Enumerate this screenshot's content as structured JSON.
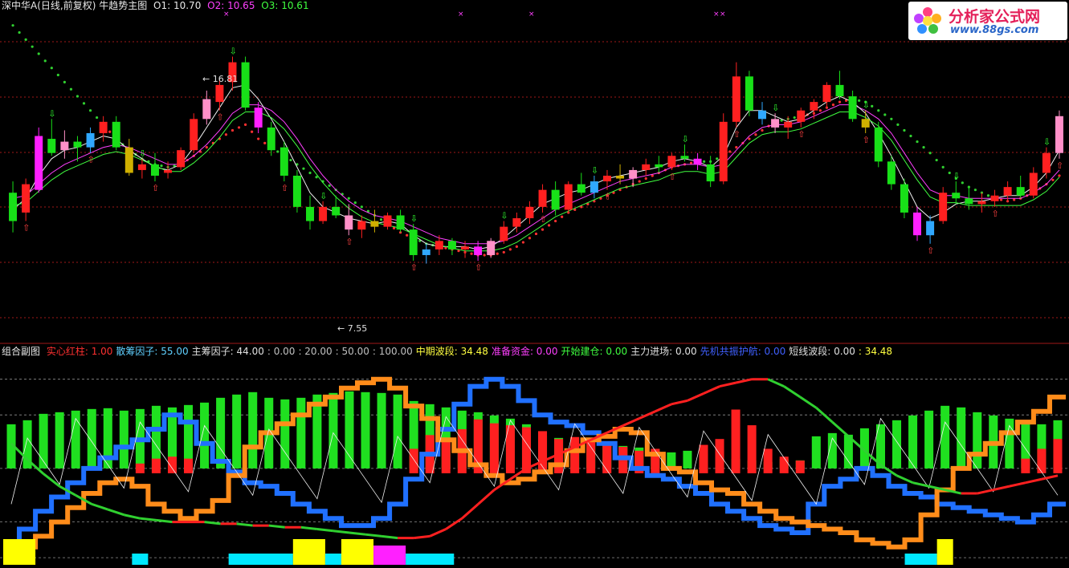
{
  "header": {
    "title": "深中华A(日线,前复权) 牛趋势主图",
    "o1_label": "O1: 10.70",
    "o2_label": "O2: 10.65",
    "o3_label": "O3: 10.61"
  },
  "subheader": {
    "name": "组合副图",
    "items": [
      {
        "label": "实心红柱: 1.00",
        "color": "#ff3030"
      },
      {
        "label": "散筹因子: 55.00",
        "color": "#60d0ff"
      },
      {
        "label": "主筹因子: 44.00",
        "color": "#e0e0e0"
      },
      {
        "label": ": 0.00",
        "color": "#c0c0c0"
      },
      {
        "label": ": 20.00",
        "color": "#c0c0c0"
      },
      {
        "label": ": 50.00",
        "color": "#c0c0c0"
      },
      {
        "label": ": 100.00",
        "color": "#c0c0c0"
      },
      {
        "label": "中期波段: 34.48",
        "color": "#ffff40"
      },
      {
        "label": "准备资金: 0.00",
        "color": "#ff40ff"
      },
      {
        "label": "开始建仓: 0.00",
        "color": "#40ff40"
      },
      {
        "label": "主力进场: 0.00",
        "color": "#e0e0e0"
      },
      {
        "label": "先机共振护航: 0.00",
        "color": "#4060ff"
      },
      {
        "label": "短线波段: 0.00",
        "color": "#e0e0e0"
      },
      {
        "label": ": 34.48",
        "color": "#ffff40"
      }
    ]
  },
  "logo": {
    "name": "分析家公式网",
    "url": "www.88gs.com"
  },
  "colors": {
    "up": "#ff2020",
    "down": "#18e018",
    "grid": "#a01818",
    "orange": "#ff8c1a",
    "blue": "#2070ff",
    "cyan": "#00e8ff",
    "yellow": "#ffff00",
    "magenta": "#ff20ff",
    "pink": "#ff90c8",
    "sky": "#30a8ff"
  },
  "chart_data": [
    {
      "type": "candlestick",
      "title": "牛趋势主图",
      "annotations": [
        {
          "text": "16.81",
          "kind": "high"
        },
        {
          "text": "7.55",
          "kind": "low"
        }
      ],
      "ylim": [
        6.8,
        18.4
      ],
      "candles": [
        [
          12.0,
          12.4,
          10.6,
          11.0
        ],
        [
          11.3,
          12.5,
          11.0,
          12.3
        ],
        [
          12.1,
          14.3,
          12.0,
          14.0
        ],
        [
          13.9,
          14.6,
          13.3,
          13.4
        ],
        [
          13.5,
          14.2,
          13.2,
          13.8
        ],
        [
          13.8,
          14.0,
          13.1,
          13.6
        ],
        [
          13.6,
          14.3,
          13.4,
          14.1
        ],
        [
          14.1,
          14.7,
          13.8,
          14.5
        ],
        [
          14.5,
          14.7,
          13.5,
          13.6
        ],
        [
          13.6,
          13.9,
          12.6,
          12.7
        ],
        [
          12.8,
          13.2,
          12.5,
          13.0
        ],
        [
          13.0,
          13.4,
          12.4,
          12.6
        ],
        [
          12.7,
          13.1,
          12.5,
          12.8
        ],
        [
          12.9,
          13.6,
          12.8,
          13.5
        ],
        [
          13.5,
          14.8,
          13.4,
          14.6
        ],
        [
          14.6,
          15.6,
          14.4,
          15.3
        ],
        [
          15.2,
          16.0,
          14.9,
          15.8
        ],
        [
          15.9,
          16.8,
          15.6,
          16.6
        ],
        [
          16.6,
          16.8,
          14.9,
          15.0
        ],
        [
          15.0,
          15.2,
          14.1,
          14.3
        ],
        [
          14.3,
          14.5,
          13.3,
          13.5
        ],
        [
          13.6,
          13.8,
          12.4,
          12.6
        ],
        [
          12.6,
          12.8,
          11.3,
          11.5
        ],
        [
          11.5,
          11.9,
          10.7,
          11.0
        ],
        [
          11.0,
          11.7,
          10.9,
          11.5
        ],
        [
          11.5,
          11.9,
          11.1,
          11.2
        ],
        [
          11.2,
          11.6,
          10.5,
          10.7
        ],
        [
          10.7,
          11.2,
          10.4,
          11.0
        ],
        [
          11.0,
          11.4,
          10.6,
          10.8
        ],
        [
          10.8,
          11.3,
          10.7,
          11.2
        ],
        [
          11.2,
          11.4,
          10.6,
          10.7
        ],
        [
          10.7,
          10.9,
          9.6,
          9.8
        ],
        [
          9.8,
          10.2,
          9.5,
          10.0
        ],
        [
          10.0,
          10.5,
          9.8,
          10.3
        ],
        [
          10.3,
          10.4,
          9.8,
          10.0
        ],
        [
          10.0,
          10.3,
          9.7,
          10.1
        ],
        [
          10.1,
          10.3,
          9.6,
          9.8
        ],
        [
          9.8,
          10.4,
          9.7,
          10.3
        ],
        [
          10.3,
          11.0,
          10.2,
          10.8
        ],
        [
          10.8,
          11.3,
          10.6,
          11.1
        ],
        [
          11.1,
          11.7,
          10.9,
          11.5
        ],
        [
          11.5,
          12.3,
          11.3,
          12.1
        ],
        [
          12.1,
          12.4,
          11.2,
          11.4
        ],
        [
          11.4,
          12.4,
          11.3,
          12.3
        ],
        [
          12.3,
          12.7,
          11.9,
          12.0
        ],
        [
          12.0,
          12.6,
          11.8,
          12.4
        ],
        [
          12.4,
          12.8,
          12.1,
          12.6
        ],
        [
          12.6,
          13.0,
          12.3,
          12.5
        ],
        [
          12.5,
          12.9,
          12.2,
          12.8
        ],
        [
          12.8,
          13.2,
          12.6,
          13.0
        ],
        [
          13.0,
          13.3,
          12.7,
          12.9
        ],
        [
          12.9,
          13.4,
          12.8,
          13.3
        ],
        [
          13.3,
          13.7,
          13.1,
          13.2
        ],
        [
          13.2,
          13.4,
          12.8,
          13.0
        ],
        [
          13.0,
          13.3,
          12.2,
          12.4
        ],
        [
          12.4,
          14.8,
          12.3,
          14.5
        ],
        [
          14.5,
          16.6,
          14.3,
          16.1
        ],
        [
          16.1,
          16.3,
          14.7,
          14.9
        ],
        [
          14.9,
          15.2,
          14.4,
          14.6
        ],
        [
          14.6,
          14.8,
          14.1,
          14.3
        ],
        [
          14.3,
          14.7,
          13.9,
          14.5
        ],
        [
          14.5,
          15.0,
          14.3,
          14.9
        ],
        [
          14.9,
          15.3,
          14.6,
          15.2
        ],
        [
          15.2,
          15.9,
          15.0,
          15.8
        ],
        [
          15.8,
          16.3,
          15.3,
          15.4
        ],
        [
          15.4,
          15.6,
          14.5,
          14.6
        ],
        [
          14.6,
          14.9,
          14.1,
          14.3
        ],
        [
          14.3,
          14.5,
          12.9,
          13.1
        ],
        [
          13.1,
          13.3,
          12.1,
          12.3
        ],
        [
          12.3,
          12.5,
          11.1,
          11.3
        ],
        [
          11.3,
          11.5,
          10.3,
          10.5
        ],
        [
          10.5,
          11.2,
          10.2,
          11.0
        ],
        [
          11.0,
          12.2,
          10.9,
          12.0
        ],
        [
          12.0,
          12.4,
          11.6,
          11.8
        ],
        [
          11.8,
          12.2,
          11.4,
          11.6
        ],
        [
          11.6,
          12.0,
          11.3,
          11.7
        ],
        [
          11.7,
          12.1,
          11.5,
          11.9
        ],
        [
          11.9,
          12.4,
          11.7,
          12.2
        ],
        [
          12.2,
          12.6,
          11.8,
          11.9
        ],
        [
          11.9,
          12.9,
          11.8,
          12.7
        ],
        [
          12.7,
          13.6,
          12.5,
          13.4
        ],
        [
          13.4,
          14.9,
          13.2,
          14.7
        ]
      ],
      "ma_fast": [
        11.4,
        11.8,
        12.6,
        13.2,
        13.5,
        13.6,
        13.8,
        14.0,
        13.9,
        13.5,
        13.2,
        12.9,
        12.8,
        13.0,
        13.6,
        14.3,
        15.0,
        15.7,
        15.8,
        15.3,
        14.6,
        13.8,
        12.9,
        12.0,
        11.5,
        11.3,
        11.1,
        11.0,
        10.9,
        11.0,
        10.9,
        10.5,
        10.2,
        10.1,
        10.1,
        10.1,
        10.0,
        10.1,
        10.4,
        10.8,
        11.2,
        11.6,
        11.8,
        12.0,
        12.1,
        12.3,
        12.5,
        12.6,
        12.7,
        12.8,
        12.9,
        13.1,
        13.2,
        13.1,
        12.9,
        13.3,
        14.3,
        14.9,
        14.9,
        14.7,
        14.5,
        14.6,
        14.9,
        15.2,
        15.4,
        15.2,
        14.8,
        14.1,
        13.3,
        12.4,
        11.5,
        11.1,
        11.3,
        11.6,
        11.7,
        11.7,
        11.8,
        11.9,
        11.9,
        12.2,
        12.7,
        13.5
      ],
      "ma_slow": [
        11.8,
        11.9,
        12.3,
        12.7,
        13.0,
        13.2,
        13.4,
        13.6,
        13.7,
        13.6,
        13.4,
        13.2,
        13.0,
        13.0,
        13.3,
        13.7,
        14.2,
        14.8,
        15.1,
        15.1,
        14.9,
        14.5,
        13.9,
        13.2,
        12.6,
        12.1,
        11.7,
        11.4,
        11.2,
        11.1,
        11.0,
        10.8,
        10.6,
        10.4,
        10.3,
        10.2,
        10.2,
        10.2,
        10.3,
        10.5,
        10.8,
        11.1,
        11.4,
        11.6,
        11.8,
        12.0,
        12.2,
        12.4,
        12.5,
        12.6,
        12.7,
        12.9,
        13.0,
        13.0,
        12.9,
        13.0,
        13.5,
        14.0,
        14.3,
        14.4,
        14.4,
        14.5,
        14.7,
        14.9,
        15.1,
        15.1,
        14.9,
        14.6,
        14.1,
        13.4,
        12.7,
        12.1,
        11.9,
        11.9,
        11.8,
        11.8,
        11.8,
        11.8,
        11.8,
        12.0,
        12.3,
        12.8
      ],
      "stop_line": [
        17.9,
        17.4,
        16.9,
        16.4,
        15.9,
        15.4,
        14.9,
        14.4,
        13.9,
        13.5,
        13.2,
        13.0,
        12.9,
        13.0,
        13.3,
        13.6,
        13.9,
        14.2,
        14.4,
        13.9,
        13.6,
        13.3,
        13.0,
        12.7,
        12.4,
        12.1,
        11.8,
        11.5,
        11.2,
        10.9,
        10.6,
        10.4,
        10.2,
        10.1,
        10.0,
        9.9,
        9.8,
        9.8,
        9.9,
        10.1,
        10.4,
        10.7,
        11.0,
        11.3,
        11.5,
        11.7,
        11.9,
        12.1,
        12.3,
        12.5,
        12.7,
        12.9,
        13.0,
        13.1,
        13.1,
        13.3,
        13.6,
        13.9,
        14.2,
        14.5,
        14.6,
        14.7,
        14.8,
        15.0,
        15.2,
        15.3,
        15.2,
        14.9,
        14.6,
        14.2,
        13.8,
        13.4,
        12.9,
        12.5,
        12.2,
        12.0,
        11.8,
        11.7,
        11.8,
        12.0,
        12.3,
        12.6
      ]
    },
    {
      "type": "bar",
      "title": "组合副图",
      "ylim": [
        -4,
        112
      ],
      "green_bars": [
        55,
        60,
        68,
        70,
        72,
        74,
        75,
        72,
        74,
        78,
        76,
        79,
        82,
        88,
        92,
        95,
        88,
        86,
        88,
        92,
        94,
        96,
        95,
        94,
        92,
        84,
        80,
        76,
        72,
        70,
        66,
        62,
        55,
        40,
        38,
        30,
        34,
        30,
        28,
        26,
        24,
        20,
        22,
        18,
        15,
        12,
        10,
        8,
        12,
        10,
        40,
        44,
        42,
        50,
        55,
        60,
        66,
        72,
        78,
        76,
        70,
        66,
        62,
        58,
        55,
        60
      ],
      "red_bars": [
        0,
        0,
        0,
        0,
        0,
        0,
        0,
        0,
        5,
        10,
        12,
        10,
        0,
        0,
        0,
        0,
        0,
        0,
        0,
        0,
        0,
        0,
        0,
        0,
        0,
        20,
        34,
        30,
        40,
        50,
        46,
        44,
        42,
        38,
        30,
        32,
        28,
        26,
        22,
        18,
        20,
        0,
        0,
        24,
        30,
        60,
        44,
        20,
        12,
        8,
        0,
        0,
        0,
        0,
        0,
        0,
        0,
        0,
        0,
        0,
        0,
        0,
        0,
        10,
        20,
        30
      ],
      "orange_line": [
        2,
        6,
        12,
        20,
        28,
        36,
        42,
        44,
        40,
        30,
        26,
        22,
        26,
        32,
        46,
        62,
        70,
        75,
        80,
        86,
        90,
        95,
        98,
        100,
        95,
        85,
        78,
        66,
        60,
        52,
        46,
        42,
        44,
        48,
        52,
        60,
        66,
        68,
        72,
        70,
        58,
        50,
        48,
        42,
        38,
        36,
        30,
        26,
        22,
        20,
        18,
        16,
        14,
        10,
        8,
        6,
        10,
        24,
        38,
        50,
        58,
        64,
        70,
        76,
        82,
        90
      ],
      "blue_line": [
        8,
        16,
        26,
        34,
        42,
        50,
        56,
        62,
        66,
        72,
        80,
        76,
        64,
        54,
        48,
        42,
        40,
        36,
        30,
        26,
        22,
        18,
        18,
        22,
        30,
        44,
        58,
        72,
        86,
        96,
        100,
        96,
        88,
        80,
        76,
        74,
        70,
        64,
        56,
        50,
        46,
        44,
        40,
        36,
        30,
        26,
        22,
        18,
        16,
        14,
        30,
        40,
        44,
        50,
        46,
        40,
        36,
        34,
        30,
        28,
        26,
        24,
        22,
        20,
        24,
        30
      ],
      "curve_line": [
        64,
        55,
        47,
        40,
        35,
        30,
        27,
        24,
        22,
        21,
        20,
        20,
        20,
        19,
        19,
        18,
        18,
        17,
        17,
        16,
        15,
        14,
        13,
        12,
        11,
        11,
        12,
        16,
        22,
        30,
        38,
        44,
        50,
        54,
        58,
        62,
        66,
        70,
        74,
        78,
        82,
        86,
        88,
        92,
        96,
        98,
        100,
        100,
        96,
        90,
        84,
        76,
        68,
        60,
        52,
        46,
        42,
        40,
        38,
        36,
        36,
        38,
        40,
        42,
        44,
        46
      ],
      "bottom_blocks": [
        {
          "start": 0,
          "end": 1,
          "color": "yellow"
        },
        {
          "start": 8,
          "end": 8,
          "color": "cyan"
        },
        {
          "start": 14,
          "end": 17,
          "color": "cyan"
        },
        {
          "start": 18,
          "end": 19,
          "color": "yellow"
        },
        {
          "start": 20,
          "end": 20,
          "color": "cyan"
        },
        {
          "start": 21,
          "end": 22,
          "color": "yellow"
        },
        {
          "start": 23,
          "end": 24,
          "color": "magenta"
        },
        {
          "start": 25,
          "end": 27,
          "color": "cyan"
        },
        {
          "start": 56,
          "end": 57,
          "color": "cyan"
        },
        {
          "start": 58,
          "end": 58,
          "color": "yellow"
        }
      ]
    }
  ]
}
